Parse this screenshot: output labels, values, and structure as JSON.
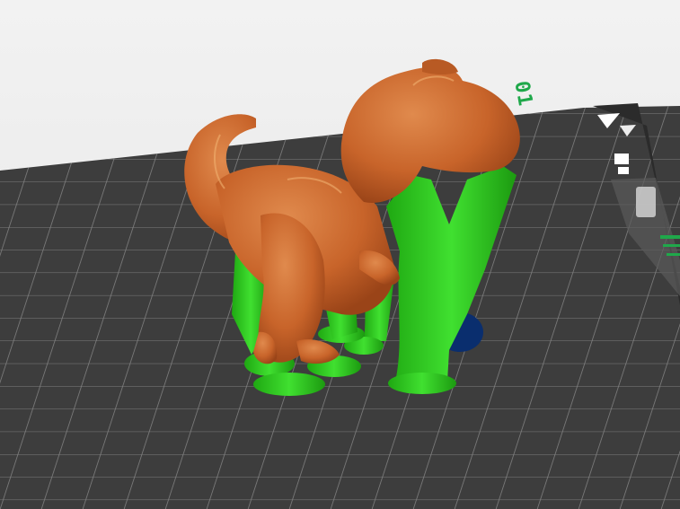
{
  "viewport": {
    "plate_label": "01",
    "bed_color": "#3d3d3d",
    "grid_color": "#8a8a8a",
    "model_color": "#c8642a",
    "support_color": "#2ec81f",
    "accent_color": "#1fa84a"
  },
  "bed_icons": [
    {
      "name": "triangle-notch-icon"
    },
    {
      "name": "bed-settings-icon"
    },
    {
      "name": "plate-slot-icon"
    }
  ]
}
